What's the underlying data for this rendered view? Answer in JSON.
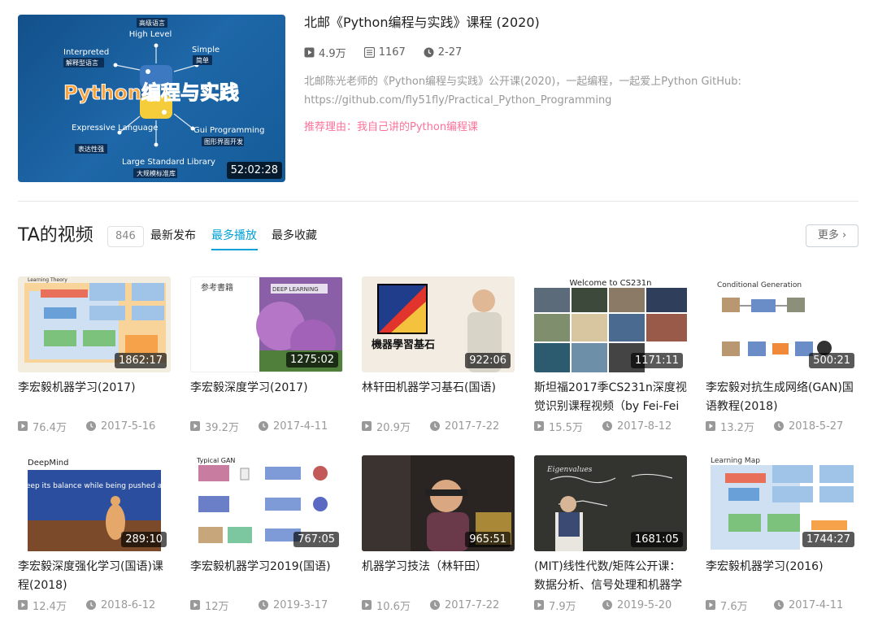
{
  "featured": {
    "title": "北邮《Python编程与实践》课程 (2020)",
    "duration": "52:02:28",
    "plays": "4.9万",
    "videos": "1167",
    "date": "2-27",
    "description": "北邮陈光老师的《Python编程与实践》公开课(2020)，一起编程，一起爱上Python GitHub: https://github.com/fly51fly/Practical_Python_Programming",
    "reason": "推荐理由：我自己讲的Python编程课",
    "thumb": {
      "banner": "Python编程与实践",
      "top_label_cn": "高级语言",
      "top_label_en": "High Level",
      "left1_en": "Interpreted",
      "left1_cn": "解释型语言",
      "right1_en": "Simple",
      "right1_cn": "简单",
      "left2_en": "Expressive Language",
      "left2_cn": "表达性强",
      "right2_en": "Gui Programming",
      "right2_cn": "图形界面开发",
      "bottom_en": "Large Standard Library",
      "bottom_cn": "大规模标准库"
    }
  },
  "section": {
    "title": "TA的视频",
    "count": "846",
    "tabs": [
      "最新发布",
      "最多播放",
      "最多收藏"
    ],
    "more": "更多"
  },
  "videos": [
    {
      "title": "李宏毅机器学习(2017)",
      "duration": "1862:17",
      "plays": "76.4万",
      "date": "2017-5-16"
    },
    {
      "title": "李宏毅深度学习(2017)",
      "duration": "1275:02",
      "plays": "39.2万",
      "date": "2017-4-11"
    },
    {
      "title": "林轩田机器学习基石(国语)",
      "duration": "922:06",
      "plays": "20.9万",
      "date": "2017-7-22"
    },
    {
      "title": "斯坦福2017季CS231n深度视觉识别课程视频（by Fei-Fei",
      "duration": "1171:11",
      "plays": "15.5万",
      "date": "2017-8-12"
    },
    {
      "title": "李宏毅对抗生成网络(GAN)国语教程(2018)",
      "duration": "500:21",
      "plays": "13.2万",
      "date": "2018-5-27"
    },
    {
      "title": "李宏毅深度强化学习(国语)课程(2018)",
      "duration": "289:10",
      "plays": "12.4万",
      "date": "2018-6-12"
    },
    {
      "title": "李宏毅机器学习2019(国语)",
      "duration": "767:05",
      "plays": "12万",
      "date": "2019-3-17"
    },
    {
      "title": "机器学习技法（林轩田）",
      "duration": "965:51",
      "plays": "10.6万",
      "date": "2017-7-22"
    },
    {
      "title": "(MIT)线性代数/矩阵公开课：数据分析、信号处理和机器学",
      "duration": "1681:05",
      "plays": "7.9万",
      "date": "2019-5-20"
    },
    {
      "title": "李宏毅机器学习(2016)",
      "duration": "1744:27",
      "plays": "7.6万",
      "date": "2017-4-11"
    }
  ],
  "thumb_text": {
    "v1_header": "Learning Theory",
    "v2_header": "参考書籍",
    "v2_book": "DEEP LEARNING",
    "v3_caption": "機器學習基石",
    "v4_header": "Welcome to CS231n",
    "v5_header": "Conditional Generation",
    "v6_header": "DeepMind",
    "v6_caption": "And keep its balance while being pushed around",
    "v7_header": "Typical GAN",
    "v9_board": "Eigenvalues",
    "v10_header": "Learning Map"
  },
  "colors": {
    "accent": "#00a1d6",
    "reason": "#fb7299",
    "meta": "#999999"
  },
  "icons": {
    "play": "play-icon",
    "list": "list-icon",
    "clock": "clock-icon"
  }
}
